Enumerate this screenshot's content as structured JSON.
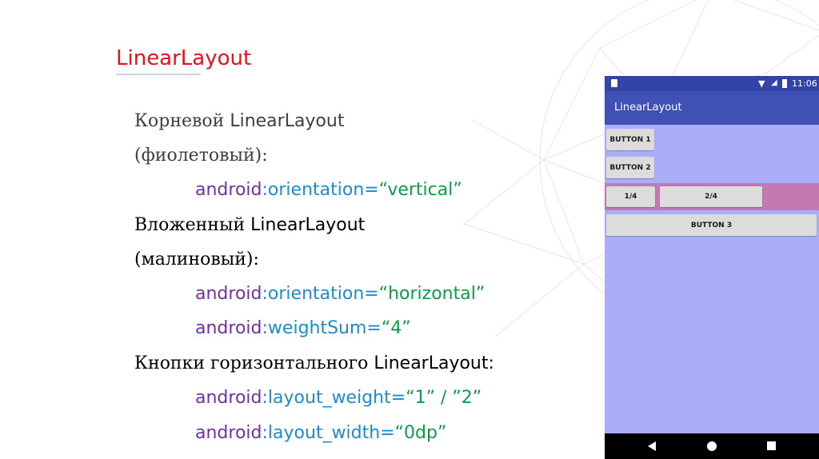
{
  "slide": {
    "title": "LinearLayout"
  },
  "lines": {
    "l1_ru": "Корневой ",
    "l1_lat": "LinearLayout",
    "l2_ru": "(фиолетовый):",
    "l3_attr": "android",
    "l3_sep": ":",
    "l3_name": "orientation=",
    "l3_val": "“vertical”",
    "l4_ru": "Вложенный ",
    "l4_lat": "LinearLayout",
    "l5_ru": "(малиновый):",
    "l6_attr": "android",
    "l6_sep": ":",
    "l6_name": "orientation=",
    "l6_val": "“horizontal”",
    "l7_attr": "android",
    "l7_sep": ":",
    "l7_name": "weightSum=",
    "l7_val": "“4”",
    "l8_ru": "Кнопки горизонтального ",
    "l8_lat": "LinearLayout:",
    "l9_attr": "android",
    "l9_sep": ":",
    "l9_name": "layout_weight=",
    "l9_val": "“1” / ”2”",
    "l10_attr": "android",
    "l10_sep": ":",
    "l10_name": "layout_width=",
    "l10_val": "“0dp”"
  },
  "phone": {
    "status_time": "11:06",
    "app_title": "LinearLayout",
    "button1": "BUTTON 1",
    "button2": "BUTTON 2",
    "button_quarter": "1/4",
    "button_half": "2/4",
    "button3": "BUTTON 3"
  },
  "colors": {
    "title": "#e4141b",
    "root_layout": "#aaaef9",
    "nested_layout": "#c47ab0",
    "app_bar": "#3f51b5",
    "status_bar": "#3344a6"
  },
  "icons": [
    "sd-card-icon",
    "wifi-icon",
    "signal-icon",
    "battery-icon",
    "back-icon",
    "home-icon",
    "recents-icon"
  ]
}
